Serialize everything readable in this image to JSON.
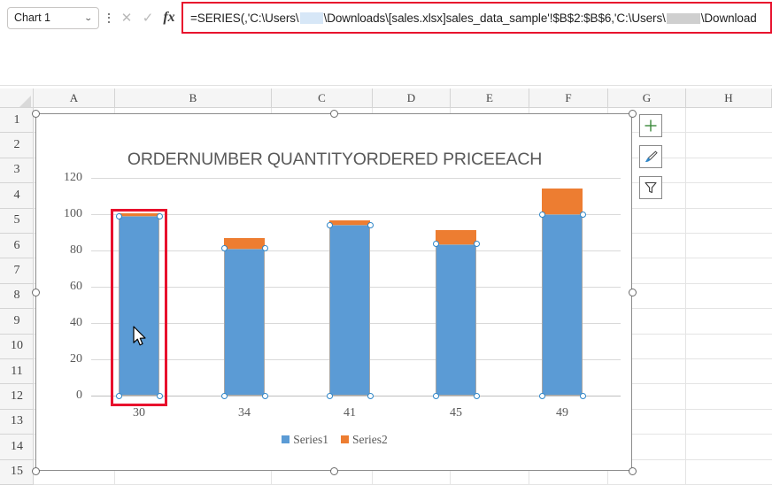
{
  "formula_bar": {
    "name_box_value": "Chart 1",
    "name_box_caret": "⌄",
    "cancel_icon": "✕",
    "confirm_icon": "✓",
    "fx_label": "fx",
    "formula_prefix": "=SERIES(,'C:\\Users\\",
    "formula_mid": "\\Downloads\\[sales.xlsx]sales_data_sample'!$B$2:$B$6,'C:\\Users\\",
    "formula_suffix": "\\Download",
    "highlight_color": "#e8112d"
  },
  "grid": {
    "columns": [
      "A",
      "B",
      "C",
      "D",
      "E",
      "F",
      "G",
      "H"
    ],
    "column_x": [
      38,
      130,
      307,
      421,
      509,
      598,
      687,
      775
    ],
    "column_w": [
      92,
      177,
      114,
      88,
      89,
      89,
      88,
      97
    ],
    "rows": [
      "1",
      "2",
      "3",
      "4",
      "5",
      "6",
      "7",
      "8",
      "9",
      "10",
      "11",
      "12",
      "13",
      "14",
      "15"
    ],
    "row_h": 28.4
  },
  "chart_buttons": [
    {
      "name": "chart-elements-button",
      "glyph": "+",
      "color": "#3a8a3a"
    },
    {
      "name": "chart-styles-button",
      "glyph": "✎",
      "color": "#2e86c8"
    },
    {
      "name": "chart-filters-button",
      "glyph": "▽",
      "color": "#3b3b3b"
    }
  ],
  "chart_data": {
    "type": "bar",
    "subtype": "stacked-column",
    "title": "ORDERNUMBER QUANTITYORDERED PRICEEACH",
    "categories": [
      "30",
      "34",
      "41",
      "45",
      "49"
    ],
    "series": [
      {
        "name": "Series1",
        "color": "#5b9bd5",
        "values": [
          99,
          81,
          94,
          83.5,
          100
        ]
      },
      {
        "name": "Series2",
        "color": "#ed7d31",
        "values": [
          1.5,
          6,
          2.5,
          7.5,
          14
        ]
      }
    ],
    "ylim": [
      0,
      120
    ],
    "yticks": [
      0,
      20,
      40,
      60,
      80,
      100,
      120
    ],
    "xlabel": "",
    "ylabel": "",
    "grid": true,
    "legend_position": "bottom",
    "selected_series": "Series1",
    "highlighted_category": "30"
  }
}
